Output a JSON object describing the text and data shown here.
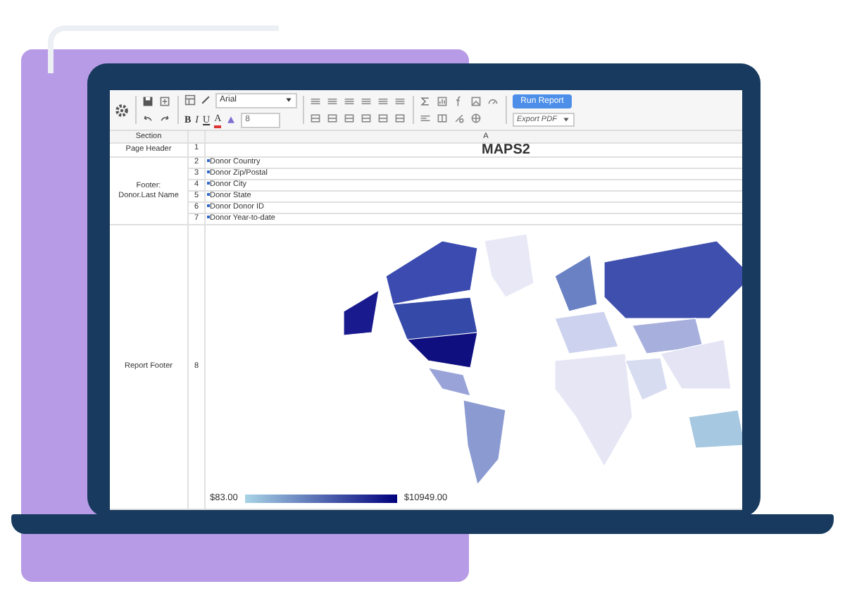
{
  "toolbar": {
    "font": "Arial",
    "font_size": "8",
    "format_buttons": [
      {
        "label": "B",
        "kind": "bold"
      },
      {
        "label": "I",
        "kind": "italic"
      },
      {
        "label": "U",
        "kind": "underline"
      },
      {
        "label": "A",
        "kind": "color"
      }
    ],
    "run_button": "Run Report",
    "export": "Export PDF"
  },
  "grid": {
    "columns": [
      "Section",
      "A"
    ],
    "sections": [
      {
        "label": "Page Header",
        "rows": [
          {
            "number": "1",
            "kind": "title",
            "text": "MAPS2"
          }
        ]
      },
      {
        "label": "Footer: Donor.Last Name",
        "rows": [
          {
            "number": "2",
            "kind": "field",
            "text": "Donor Country"
          },
          {
            "number": "3",
            "kind": "field",
            "text": "Donor Zip/Postal"
          },
          {
            "number": "4",
            "kind": "field",
            "text": "Donor City"
          },
          {
            "number": "5",
            "kind": "field",
            "text": "Donor State"
          },
          {
            "number": "6",
            "kind": "field",
            "text": "Donor Donor ID"
          },
          {
            "number": "7",
            "kind": "field",
            "text": "Donor Year-to-date"
          }
        ]
      },
      {
        "label": "Report Footer",
        "rows": [
          {
            "number": "8",
            "kind": "map",
            "legend_min": "$83.00",
            "legend_max": "$10949.00"
          }
        ]
      }
    ]
  }
}
